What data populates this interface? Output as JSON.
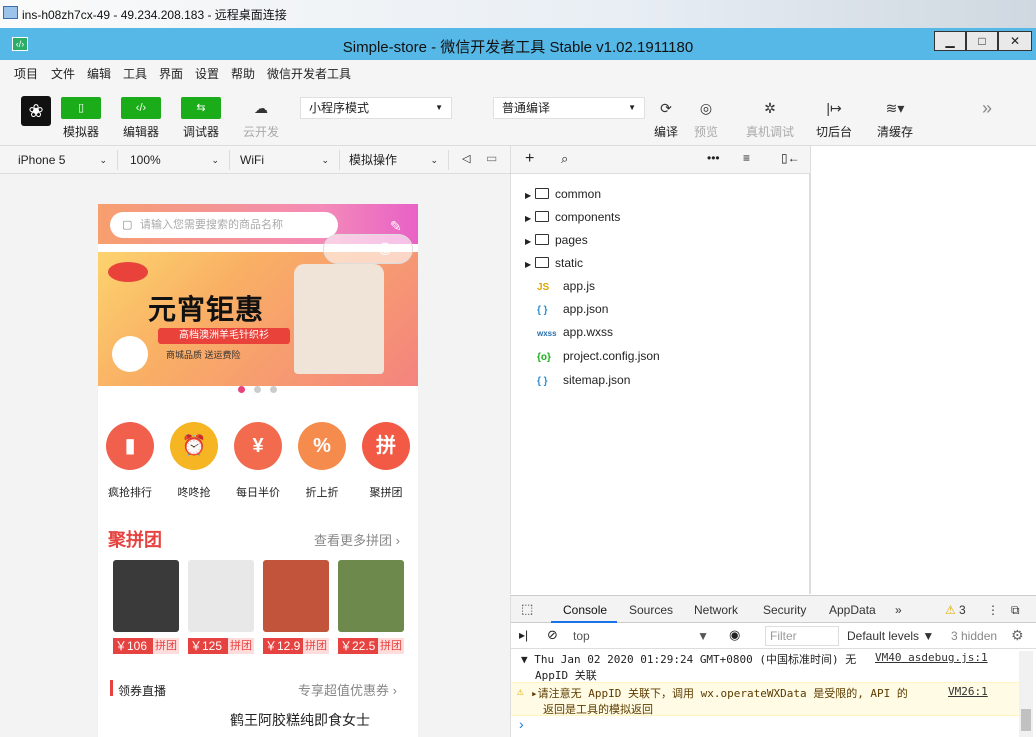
{
  "rdp": {
    "title": "ins-h08zh7cx-49 - 49.234.208.183 - 远程桌面连接"
  },
  "window": {
    "title": "Simple-store - 微信开发者工具 Stable v1.02.1911180",
    "min": "▁",
    "max": "□",
    "close": "✕"
  },
  "menu": [
    "项目",
    "文件",
    "编辑",
    "工具",
    "界面",
    "设置",
    "帮助",
    "微信开发者工具"
  ],
  "toolbar": {
    "simulator": "模拟器",
    "editor": "编辑器",
    "debugger": "调试器",
    "cloud": "云开发",
    "mode_select": "小程序模式",
    "compile_select": "普通编译",
    "compile": "编译",
    "preview": "预览",
    "remote_debug": "真机调试",
    "background": "切后台",
    "clear_cache": "清缓存"
  },
  "devbar": {
    "device": "iPhone 5",
    "zoom": "100%",
    "network": "WiFi",
    "operation": "模拟操作"
  },
  "tree": {
    "folders": [
      "common",
      "components",
      "pages",
      "static"
    ],
    "files": [
      {
        "icon": "JS",
        "name": "app.js",
        "color": "#e0a800"
      },
      {
        "icon": "{ }",
        "name": "app.json",
        "color": "#2a8fd6"
      },
      {
        "icon": "wxss",
        "name": "app.wxss",
        "color": "#2a6fb0"
      },
      {
        "icon": "{o}",
        "name": "project.config.json",
        "color": "#1aad19"
      },
      {
        "icon": "{ }",
        "name": "sitemap.json",
        "color": "#2a8fd6"
      }
    ]
  },
  "console": {
    "tabs": [
      "Console",
      "Sources",
      "Network",
      "Security",
      "AppData"
    ],
    "more": "»",
    "warn_count": "3",
    "context": "top",
    "filter_placeholder": "Filter",
    "levels": "Default levels ▼",
    "hidden": "3 hidden",
    "log1": "Thu Jan 02 2020 01:29:24 GMT+0800 (中国标准时间) 无",
    "log1b": "AppID 关联",
    "log1_src": "VM40 asdebug.js:1",
    "warn": "请注意无 AppID 关联下，调用 wx.operateWXData 是受限的, API 的",
    "warn2": "返回是工具的模拟返回",
    "warn_src": "VM26:1",
    "prompt": "›"
  },
  "phone": {
    "search_placeholder": "请输入您需要搜索的商品名称",
    "banner_title": "元宵钜惠",
    "banner_sub": "高档澳洲羊毛针织衫",
    "banner_sub2": "商城品质  送运费险",
    "categories": [
      {
        "label": "疯抢排行",
        "icon": "▮",
        "color": "#f0604d"
      },
      {
        "label": "咚咚抢",
        "icon": "⏰",
        "color": "#f6b522"
      },
      {
        "label": "每日半价",
        "icon": "¥",
        "color": "#f26b4e"
      },
      {
        "label": "折上折",
        "icon": "%",
        "color": "#f58b4c"
      },
      {
        "label": "聚拼团",
        "icon": "拼",
        "color": "#f25a45"
      }
    ],
    "group_title": "聚拼团",
    "group_more": "查看更多拼团",
    "products": [
      {
        "price": "￥106",
        "tag": "拼团",
        "color": "#3a3a3a"
      },
      {
        "price": "￥125",
        "tag": "拼团",
        "color": "#e8e8e8"
      },
      {
        "price": "￥12.9",
        "tag": "拼团",
        "color": "#c2543b"
      },
      {
        "price": "￥22.5",
        "tag": "拼团",
        "color": "#6d8a4c"
      }
    ],
    "live_title": "领券直播",
    "live_more": "专享超值优惠券",
    "live_item": "鹤王阿胶糕纯即食女士"
  }
}
